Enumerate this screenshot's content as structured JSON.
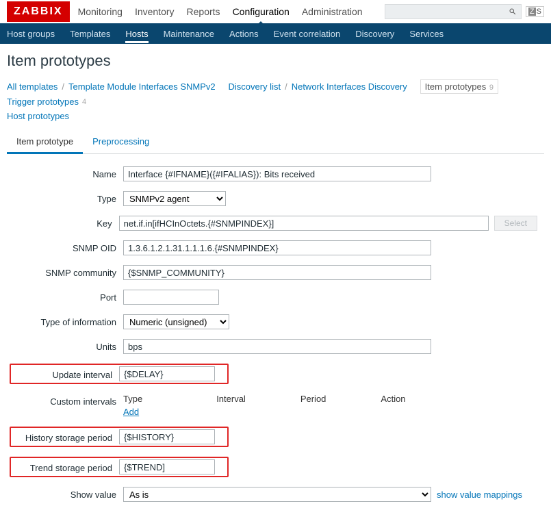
{
  "brand": "ZABBIX",
  "topnav": [
    "Monitoring",
    "Inventory",
    "Reports",
    "Configuration",
    "Administration"
  ],
  "topnav_active": 3,
  "zs": "S",
  "subnav": [
    "Host groups",
    "Templates",
    "Hosts",
    "Maintenance",
    "Actions",
    "Event correlation",
    "Discovery",
    "Services"
  ],
  "subnav_active": 2,
  "page_title": "Item prototypes",
  "breadcrumb": {
    "items": [
      "All templates",
      "Template Module Interfaces SNMPv2"
    ],
    "group2": [
      "Discovery list",
      "Network Interfaces Discovery"
    ],
    "current": "Item prototypes",
    "current_count": "9",
    "trigger": "Trigger prototypes",
    "trigger_count": "4",
    "host": "Host prototypes"
  },
  "tabs": [
    "Item prototype",
    "Preprocessing"
  ],
  "tabs_active": 0,
  "form": {
    "name_label": "Name",
    "name_value": "Interface {#IFNAME}({#IFALIAS}): Bits received",
    "type_label": "Type",
    "type_value": "SNMPv2 agent",
    "key_label": "Key",
    "key_value": "net.if.in[ifHCInOctets.{#SNMPINDEX}]",
    "select_btn": "Select",
    "oid_label": "SNMP OID",
    "oid_value": "1.3.6.1.2.1.31.1.1.1.6.{#SNMPINDEX}",
    "community_label": "SNMP community",
    "community_value": "{$SNMP_COMMUNITY}",
    "port_label": "Port",
    "port_value": "",
    "info_label": "Type of information",
    "info_value": "Numeric (unsigned)",
    "units_label": "Units",
    "units_value": "bps",
    "update_label": "Update interval",
    "update_value": "{$DELAY}",
    "custom_label": "Custom intervals",
    "custom_cols": [
      "Type",
      "Interval",
      "Period",
      "Action"
    ],
    "custom_add": "Add",
    "history_label": "History storage period",
    "history_value": "{$HISTORY}",
    "trend_label": "Trend storage period",
    "trend_value": "{$TREND]",
    "showval_label": "Show value",
    "showval_value": "As is",
    "showval_link": "show value mappings"
  }
}
